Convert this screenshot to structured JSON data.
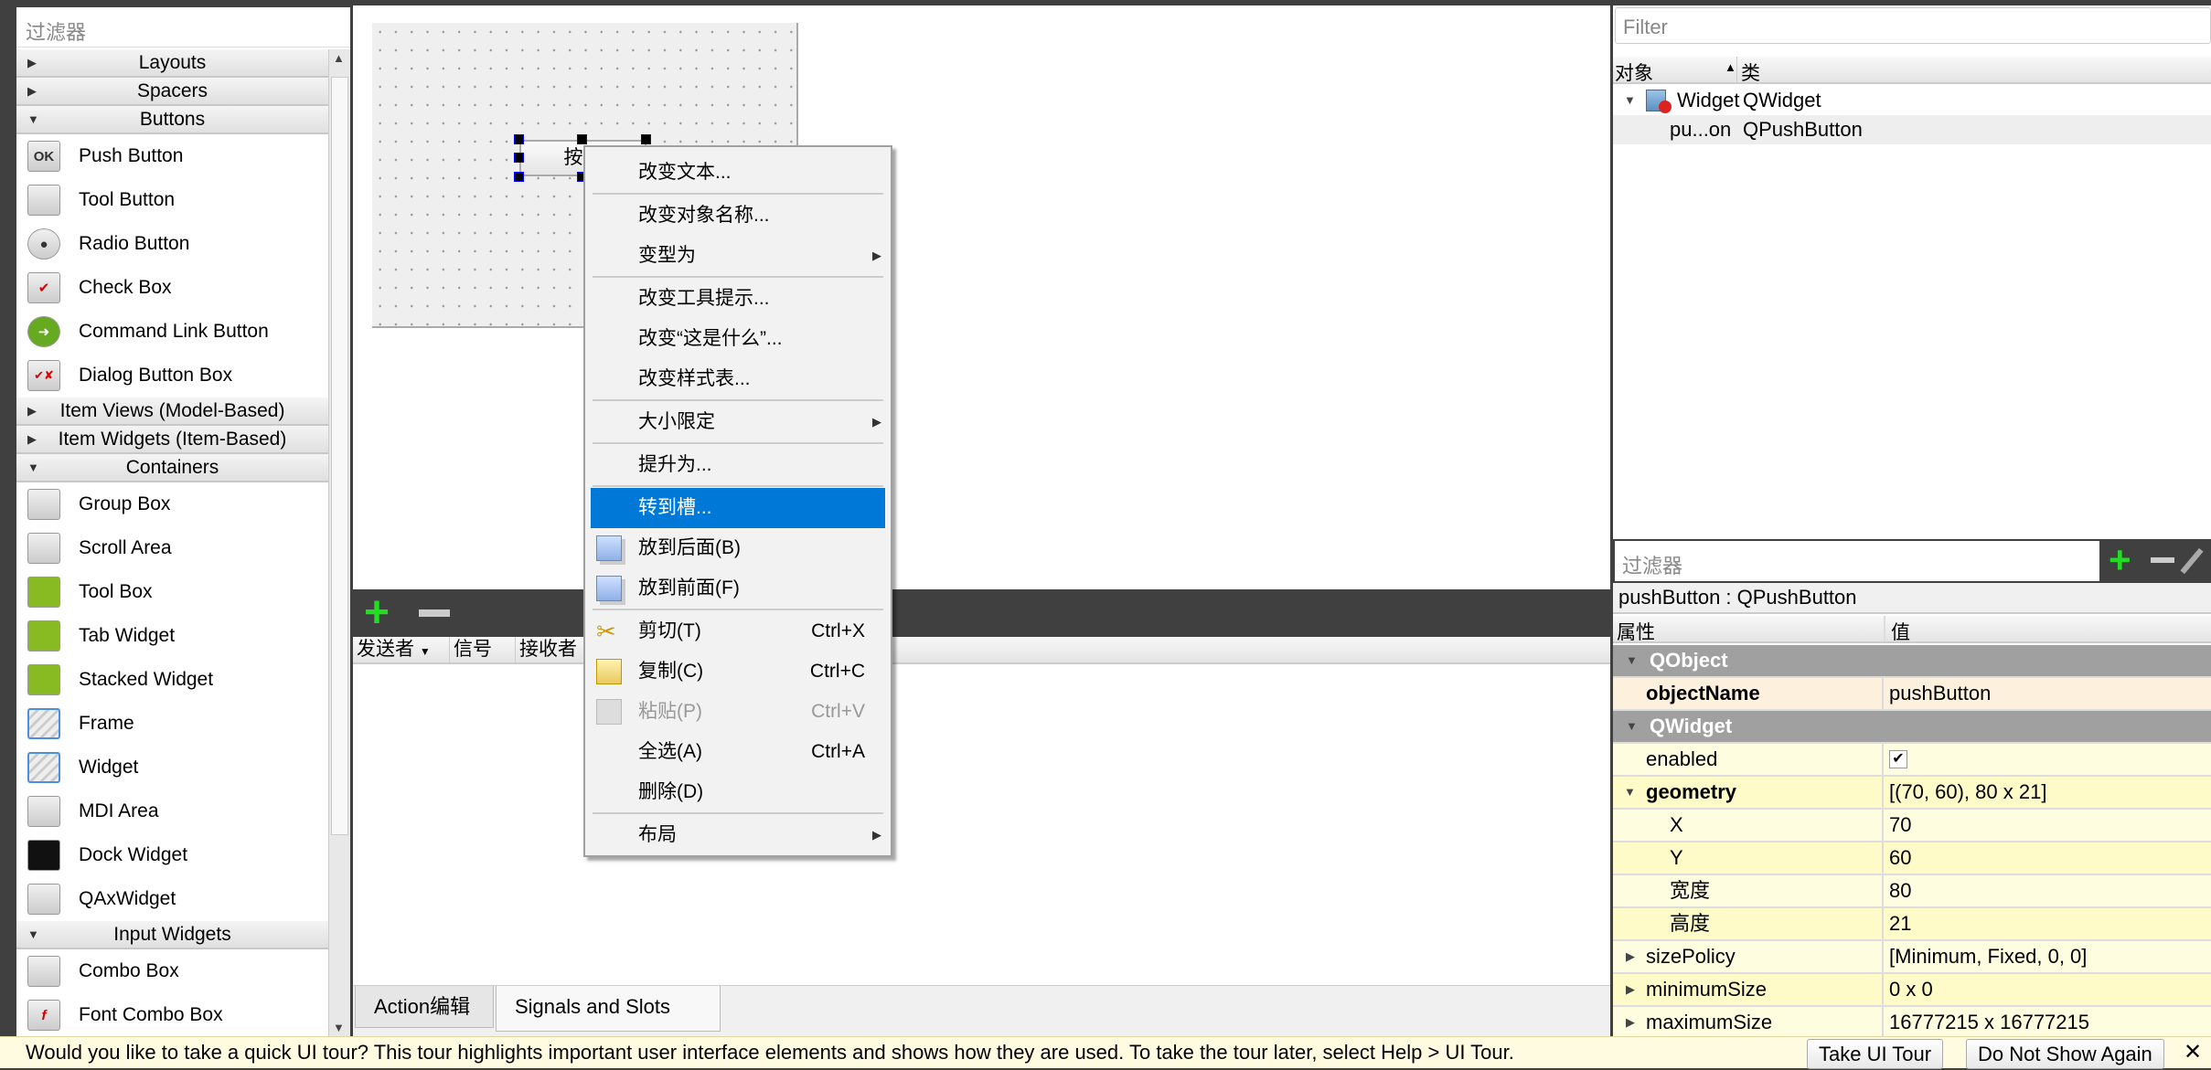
{
  "widget_box": {
    "filter_placeholder": "过滤器",
    "sections": [
      {
        "label": "Layouts",
        "expanded": false,
        "items": []
      },
      {
        "label": "Spacers",
        "expanded": false,
        "items": []
      },
      {
        "label": "Buttons",
        "expanded": true,
        "items": [
          {
            "label": "Push Button",
            "icon": "push-button-icon"
          },
          {
            "label": "Tool Button",
            "icon": "tool-button-icon"
          },
          {
            "label": "Radio Button",
            "icon": "radio-button-icon"
          },
          {
            "label": "Check Box",
            "icon": "check-box-icon"
          },
          {
            "label": "Command Link Button",
            "icon": "command-link-icon"
          },
          {
            "label": "Dialog Button Box",
            "icon": "dialog-button-box-icon"
          }
        ]
      },
      {
        "label": "Item Views (Model-Based)",
        "expanded": false,
        "items": []
      },
      {
        "label": "Item Widgets (Item-Based)",
        "expanded": false,
        "items": []
      },
      {
        "label": "Containers",
        "expanded": true,
        "items": [
          {
            "label": "Group Box",
            "icon": "group-box-icon"
          },
          {
            "label": "Scroll Area",
            "icon": "scroll-area-icon"
          },
          {
            "label": "Tool Box",
            "icon": "tool-box-icon"
          },
          {
            "label": "Tab Widget",
            "icon": "tab-widget-icon"
          },
          {
            "label": "Stacked Widget",
            "icon": "stacked-widget-icon"
          },
          {
            "label": "Frame",
            "icon": "frame-icon"
          },
          {
            "label": "Widget",
            "icon": "widget-icon"
          },
          {
            "label": "MDI Area",
            "icon": "mdi-area-icon"
          },
          {
            "label": "Dock Widget",
            "icon": "dock-widget-icon"
          },
          {
            "label": "QAxWidget",
            "icon": "qaxwidget-icon"
          }
        ]
      },
      {
        "label": "Input Widgets",
        "expanded": true,
        "items": [
          {
            "label": "Combo Box",
            "icon": "combo-box-icon"
          },
          {
            "label": "Font Combo Box",
            "icon": "font-combo-box-icon"
          }
        ]
      }
    ]
  },
  "form": {
    "push_button_text": "按钮"
  },
  "context_menu": {
    "highlight_color": "#0078d7",
    "items": [
      {
        "label": "改变文本...",
        "sep_after": true
      },
      {
        "label": "改变对象名称..."
      },
      {
        "label": "变型为",
        "submenu": true,
        "sep_after": true
      },
      {
        "label": "改变工具提示..."
      },
      {
        "label": "改变“这是什么”..."
      },
      {
        "label": "改变样式表...",
        "sep_after": true
      },
      {
        "label": "大小限定",
        "submenu": true,
        "sep_after": true
      },
      {
        "label": "提升为...",
        "sep_after": true
      },
      {
        "label": "转到槽...",
        "highlighted": true
      },
      {
        "label": "放到后面(B)",
        "icon": "send-to-back-icon"
      },
      {
        "label": "放到前面(F)",
        "icon": "bring-to-front-icon",
        "sep_after": true
      },
      {
        "label": "剪切(T)",
        "icon": "scissors-icon",
        "shortcut": "Ctrl+X"
      },
      {
        "label": "复制(C)",
        "icon": "copy-icon",
        "shortcut": "Ctrl+C"
      },
      {
        "label": "粘贴(P)",
        "icon": "paste-icon",
        "shortcut": "Ctrl+V",
        "disabled": true
      },
      {
        "label": "全选(A)",
        "shortcut": "Ctrl+A"
      },
      {
        "label": "删除(D)",
        "sep_after": true
      },
      {
        "label": "布局",
        "submenu": true
      }
    ]
  },
  "signals_editor": {
    "columns": [
      "发送者",
      "信号",
      "接收者"
    ],
    "tabs": [
      "Action编辑器",
      "Signals and Slots Editor"
    ],
    "active_tab": 1
  },
  "object_inspector": {
    "filter_placeholder": "Filter",
    "columns": [
      "对象",
      "类"
    ],
    "rows": [
      {
        "object": "Widget",
        "class": "QWidget"
      },
      {
        "object": "pu...on",
        "class": "QPushButton"
      }
    ]
  },
  "property_editor": {
    "filter_placeholder": "过滤器",
    "selected": "pushButton : QPushButton",
    "columns": [
      "属性",
      "值"
    ],
    "rows": [
      {
        "name": "QObject",
        "group": true
      },
      {
        "name": "objectName",
        "value": "pushButton",
        "bold": true,
        "bg": "#fdf0dc"
      },
      {
        "name": "QWidget",
        "group": true
      },
      {
        "name": "enabled",
        "value": "✔",
        "checkbox": true,
        "bg": "#fffde0"
      },
      {
        "name": "geometry",
        "value": "[(70, 60), 80 x 21]",
        "bold": true,
        "expanded": true,
        "bg": "#fffbc8"
      },
      {
        "name": "X",
        "value": "70",
        "child": true,
        "bg": "#fffde0"
      },
      {
        "name": "Y",
        "value": "60",
        "child": true,
        "bg": "#fffbc8"
      },
      {
        "name": "宽度",
        "value": "80",
        "child": true,
        "bg": "#fffde0"
      },
      {
        "name": "高度",
        "value": "21",
        "child": true,
        "bg": "#fffbc8"
      },
      {
        "name": "sizePolicy",
        "value": "[Minimum, Fixed, 0, 0]",
        "collapsed": true,
        "bg": "#fffde0"
      },
      {
        "name": "minimumSize",
        "value": "0 x 0",
        "collapsed": true,
        "bg": "#fffbc8"
      },
      {
        "name": "maximumSize",
        "value": "16777215 x 16777215",
        "collapsed": true,
        "bg": "#fffde0"
      }
    ]
  },
  "tour_bar": {
    "message": "Would you like to take a quick UI tour? This tour highlights important user interface elements and shows how they are used. To take the tour later, select Help > UI Tour.",
    "take_tour": "Take UI Tour",
    "dont_show": "Do Not Show Again",
    "close": "✕"
  }
}
